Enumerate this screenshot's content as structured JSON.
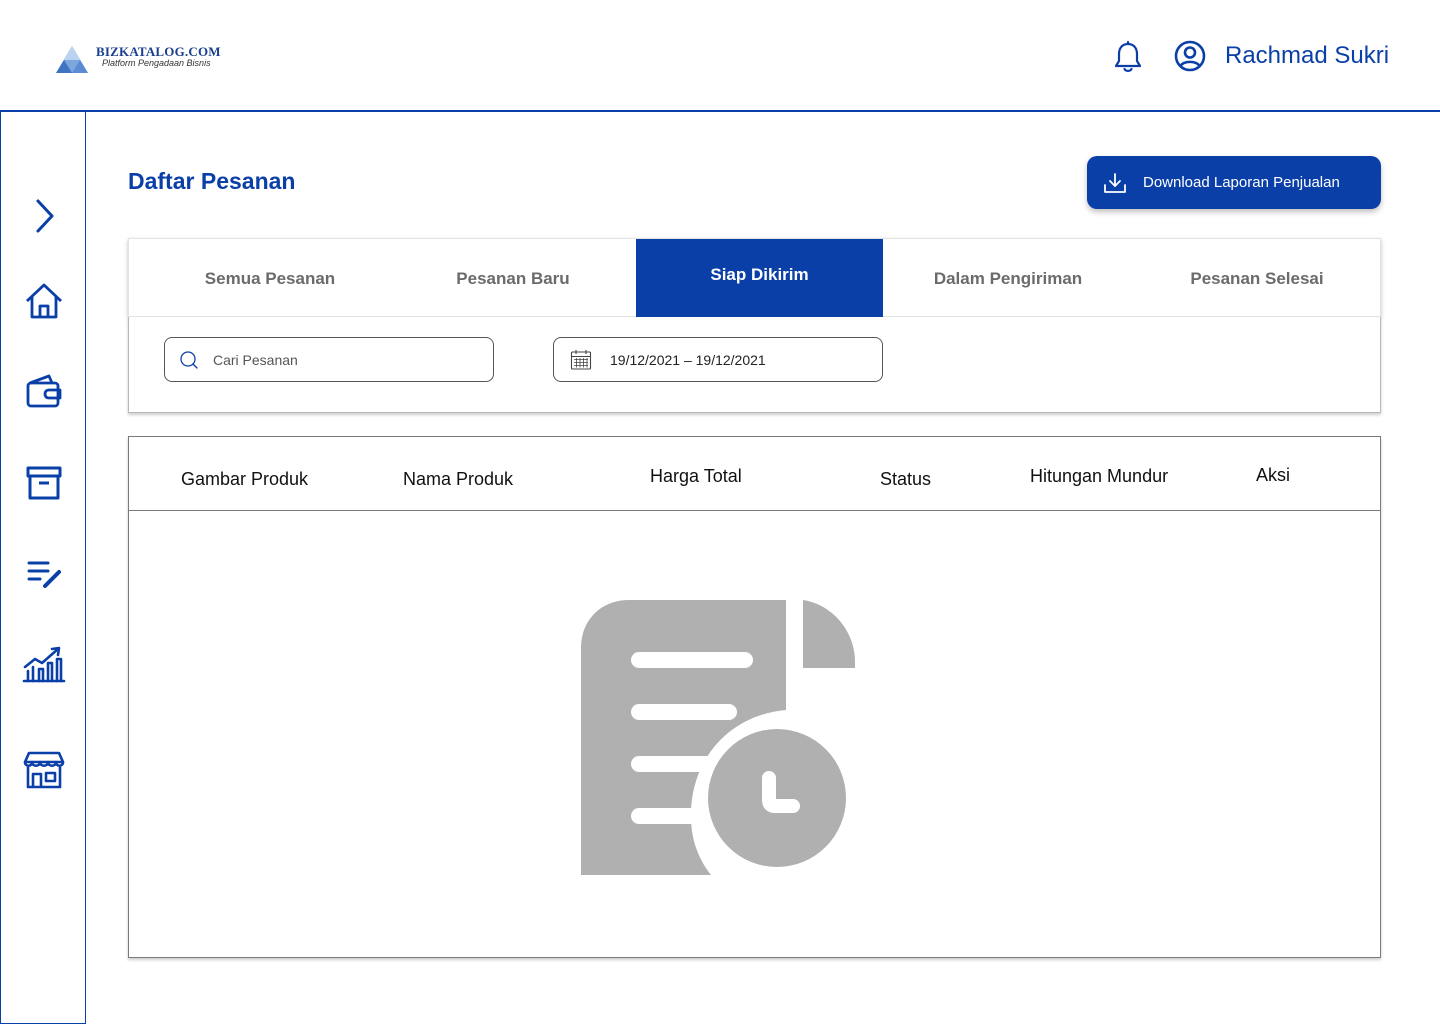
{
  "header": {
    "logo_title": "BIZKATALOG.COM",
    "logo_subtitle": "Platform Pengadaan Bisnis",
    "user_name": "Rachmad Sukri"
  },
  "sidebar": {
    "items": [
      {
        "icon": "chevron-right-icon"
      },
      {
        "icon": "home-icon"
      },
      {
        "icon": "wallet-icon"
      },
      {
        "icon": "archive-icon"
      },
      {
        "icon": "edit-list-icon"
      },
      {
        "icon": "chart-icon"
      },
      {
        "icon": "store-icon"
      }
    ]
  },
  "main": {
    "page_title": "Daftar Pesanan",
    "download_button": "Download Laporan Penjualan",
    "tabs": [
      {
        "label": "Semua Pesanan",
        "active": false
      },
      {
        "label": "Pesanan Baru",
        "active": false
      },
      {
        "label": "Siap Dikirim",
        "active": true
      },
      {
        "label": "Dalam Pengiriman",
        "active": false
      },
      {
        "label": "Pesanan Selesai",
        "active": false
      }
    ],
    "search_placeholder": "Cari Pesanan",
    "date_range": "19/12/2021 – 19/12/2021",
    "table_headers": [
      "Gambar  Produk",
      "Nama Produk",
      "Harga Total",
      "Status",
      "Hitungan Mundur",
      "Aksi"
    ],
    "empty_state_icon": "document-clock-icon"
  },
  "colors": {
    "primary": "#0a3fa8",
    "tab_inactive_text": "#6b6b6b",
    "empty_icon": "#b0b0b0"
  }
}
